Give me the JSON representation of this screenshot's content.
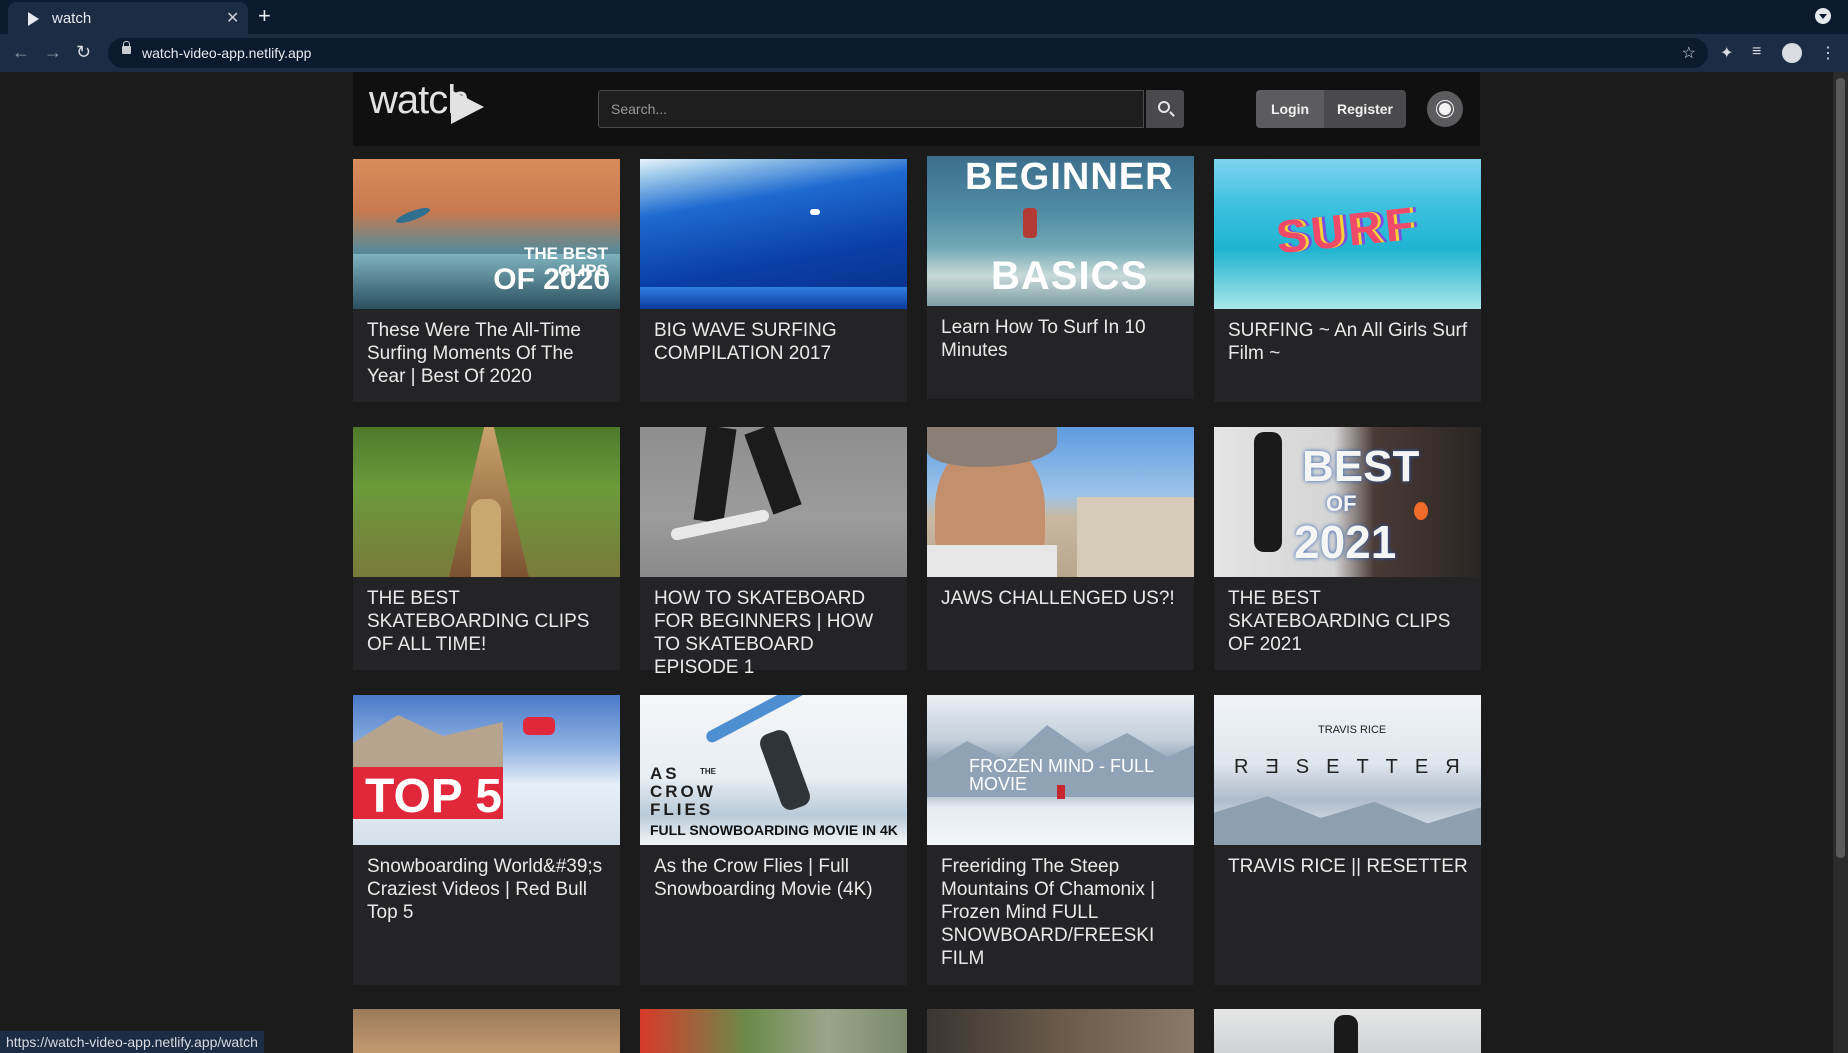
{
  "browser": {
    "tab_title": "watch",
    "new_tab": "+",
    "close": "✕",
    "url": "watch-video-app.netlify.app",
    "status_url": "https://watch-video-app.netlify.app/watch"
  },
  "header": {
    "logo_text": "watch",
    "search_placeholder": "Search...",
    "login_label": "Login",
    "register_label": "Register"
  },
  "videos": [
    {
      "title": "These Were The All-Time Surfing Moments Of The Year | Best Of 2020",
      "thumb_text": "THE BEST CLIPS\nOF 2020"
    },
    {
      "title": "BIG WAVE SURFING COMPILATION 2017",
      "thumb_text": ""
    },
    {
      "title": "Learn How To Surf In 10 Minutes",
      "thumb_text": "BEGINNER\nBASICS"
    },
    {
      "title": "SURFING ~ An All Girls Surf Film ~",
      "thumb_text": "SURF"
    },
    {
      "title": "THE BEST SKATEBOARDING CLIPS OF ALL TIME!",
      "thumb_text": ""
    },
    {
      "title": "HOW TO SKATEBOARD FOR BEGINNERS | HOW TO SKATEBOARD EPISODE 1",
      "thumb_text": ""
    },
    {
      "title": "JAWS CHALLENGED US?!",
      "thumb_text": ""
    },
    {
      "title": "THE BEST SKATEBOARDING CLIPS OF 2021",
      "thumb_text": "BEST\nOF\n2021"
    },
    {
      "title": "Snowboarding World&#39;s Craziest Videos | Red Bull Top 5",
      "thumb_text": "TOP 5"
    },
    {
      "title": "As the Crow Flies | Full Snowboarding Movie (4K)",
      "thumb_text": "AS THE CROW FLIES\nFULL SNOWBOARDING MOVIE IN 4K"
    },
    {
      "title": "Freeriding The Steep Mountains Of Chamonix | Frozen Mind FULL SNOWBOARD/FREESKI FILM",
      "thumb_text": "FROZEN MIND - FULL MOVIE"
    },
    {
      "title": "TRAVIS RICE || RESETTER",
      "thumb_text": "TRAVIS RICE\nR Ǝ S E T T E Я"
    }
  ]
}
